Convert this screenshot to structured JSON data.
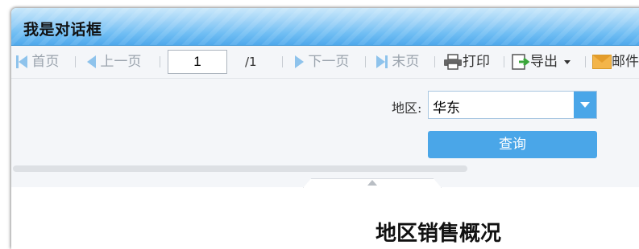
{
  "dialog": {
    "title": "我是对话框"
  },
  "toolbar": {
    "first": "首页",
    "prev": "上一页",
    "page_value": "1",
    "page_total": "/1",
    "next": "下一页",
    "last": "末页",
    "print": "打印",
    "export": "导出",
    "mail": "邮件"
  },
  "filter": {
    "region_label": "地区:",
    "region_value": "华东",
    "query_label": "查询"
  },
  "report": {
    "title_partial": "地区销售概况"
  },
  "colors": {
    "accent": "#4aa6e8",
    "titlebar": "#6fbdf3",
    "toolbar_bg": "#f4f6f9"
  }
}
